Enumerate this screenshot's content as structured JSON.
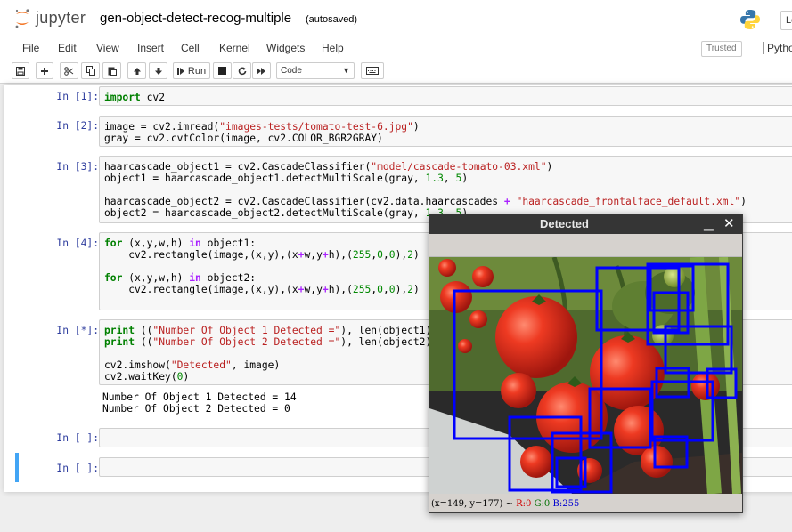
{
  "header": {
    "logo_text": "jupyter",
    "notebook_title": "gen-object-detect-recog-multiple",
    "autosave": "(autosaved)",
    "logout": "Lo"
  },
  "menubar": {
    "items": [
      "File",
      "Edit",
      "View",
      "Insert",
      "Cell",
      "Kernel",
      "Widgets",
      "Help"
    ],
    "trusted": "Trusted",
    "kernel": "Pytho"
  },
  "toolbar": {
    "run_label": "Run",
    "cell_type": "Code"
  },
  "cells": [
    {
      "prompt": "In [1]:"
    },
    {
      "prompt": "In [2]:"
    },
    {
      "prompt": "In [3]:"
    },
    {
      "prompt": "In [4]:"
    },
    {
      "prompt": "In [*]:",
      "output": [
        "Number Of Object 1 Detected = 14",
        "Number Of Object 2 Detected = 0"
      ]
    },
    {
      "prompt": "In [ ]:"
    },
    {
      "prompt": "In [ ]:"
    }
  ],
  "detected_window": {
    "title": "Detected",
    "status_prefix": "(x=149, y=177) ~ ",
    "status_r": "R:0",
    "status_g": "G:0",
    "status_b": "B:255"
  },
  "colors": {
    "accent": "#f37626",
    "prompt": "#303f9f",
    "selected_bar": "#42a5f5",
    "box": "#0000ff"
  }
}
